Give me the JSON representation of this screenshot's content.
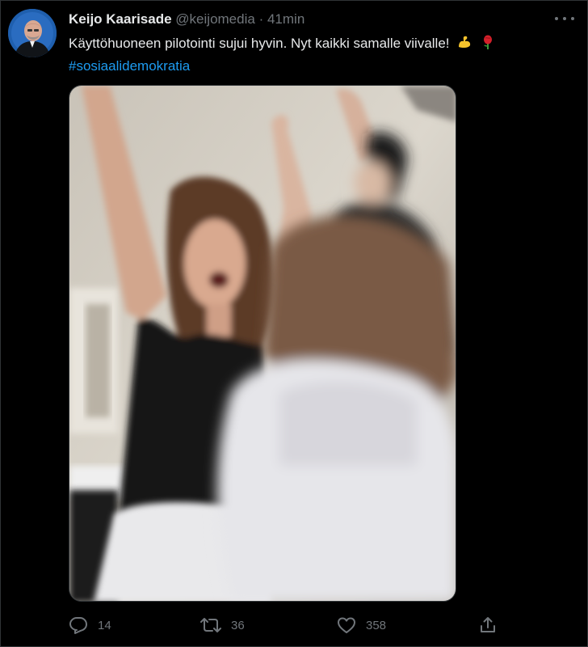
{
  "author": {
    "name": "Keijo Kaarisade",
    "handle": "@keijomedia",
    "separator": "·",
    "time": "41min"
  },
  "tweet": {
    "text": "Käyttöhuoneen pilotointi sujui hyvin. Nyt kaikki samalle viivalle!",
    "hashtag": "#sosiaalidemokratia",
    "emojis": [
      "flexed-biceps-icon",
      "rose-icon"
    ]
  },
  "media": {
    "type": "video-still"
  },
  "actions": {
    "replies": "14",
    "retweets": "36",
    "likes": "358"
  },
  "colors": {
    "background": "#000000",
    "text": "#e7e9ea",
    "muted": "#71767b",
    "link": "#1d9bf0",
    "border": "#2f3336"
  }
}
